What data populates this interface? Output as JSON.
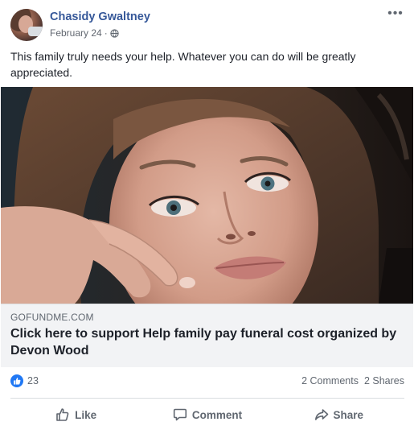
{
  "post": {
    "author": "Chasidy Gwaltney",
    "date": "February 24",
    "date_separator": "·",
    "privacy_icon": "globe-icon",
    "more_icon": "more-options-icon",
    "more_glyph": "•••",
    "text": "This family truly needs your help. Whatever you can do will be greatly appreciated."
  },
  "link_preview": {
    "domain": "GOFUNDME.COM",
    "headline": "Click here to support Help family pay funeral cost organized by Devon Wood"
  },
  "reactions": {
    "icon": "like-reaction-icon",
    "count": "23",
    "comments": "2 Comments",
    "shares": "2 Shares"
  },
  "actions": {
    "like_label": "Like",
    "comment_label": "Comment",
    "share_label": "Share"
  },
  "colors": {
    "author_link": "#365899",
    "like_blue": "#2078f4",
    "secondary_text": "#606770",
    "link_box_bg": "#f2f3f5"
  }
}
